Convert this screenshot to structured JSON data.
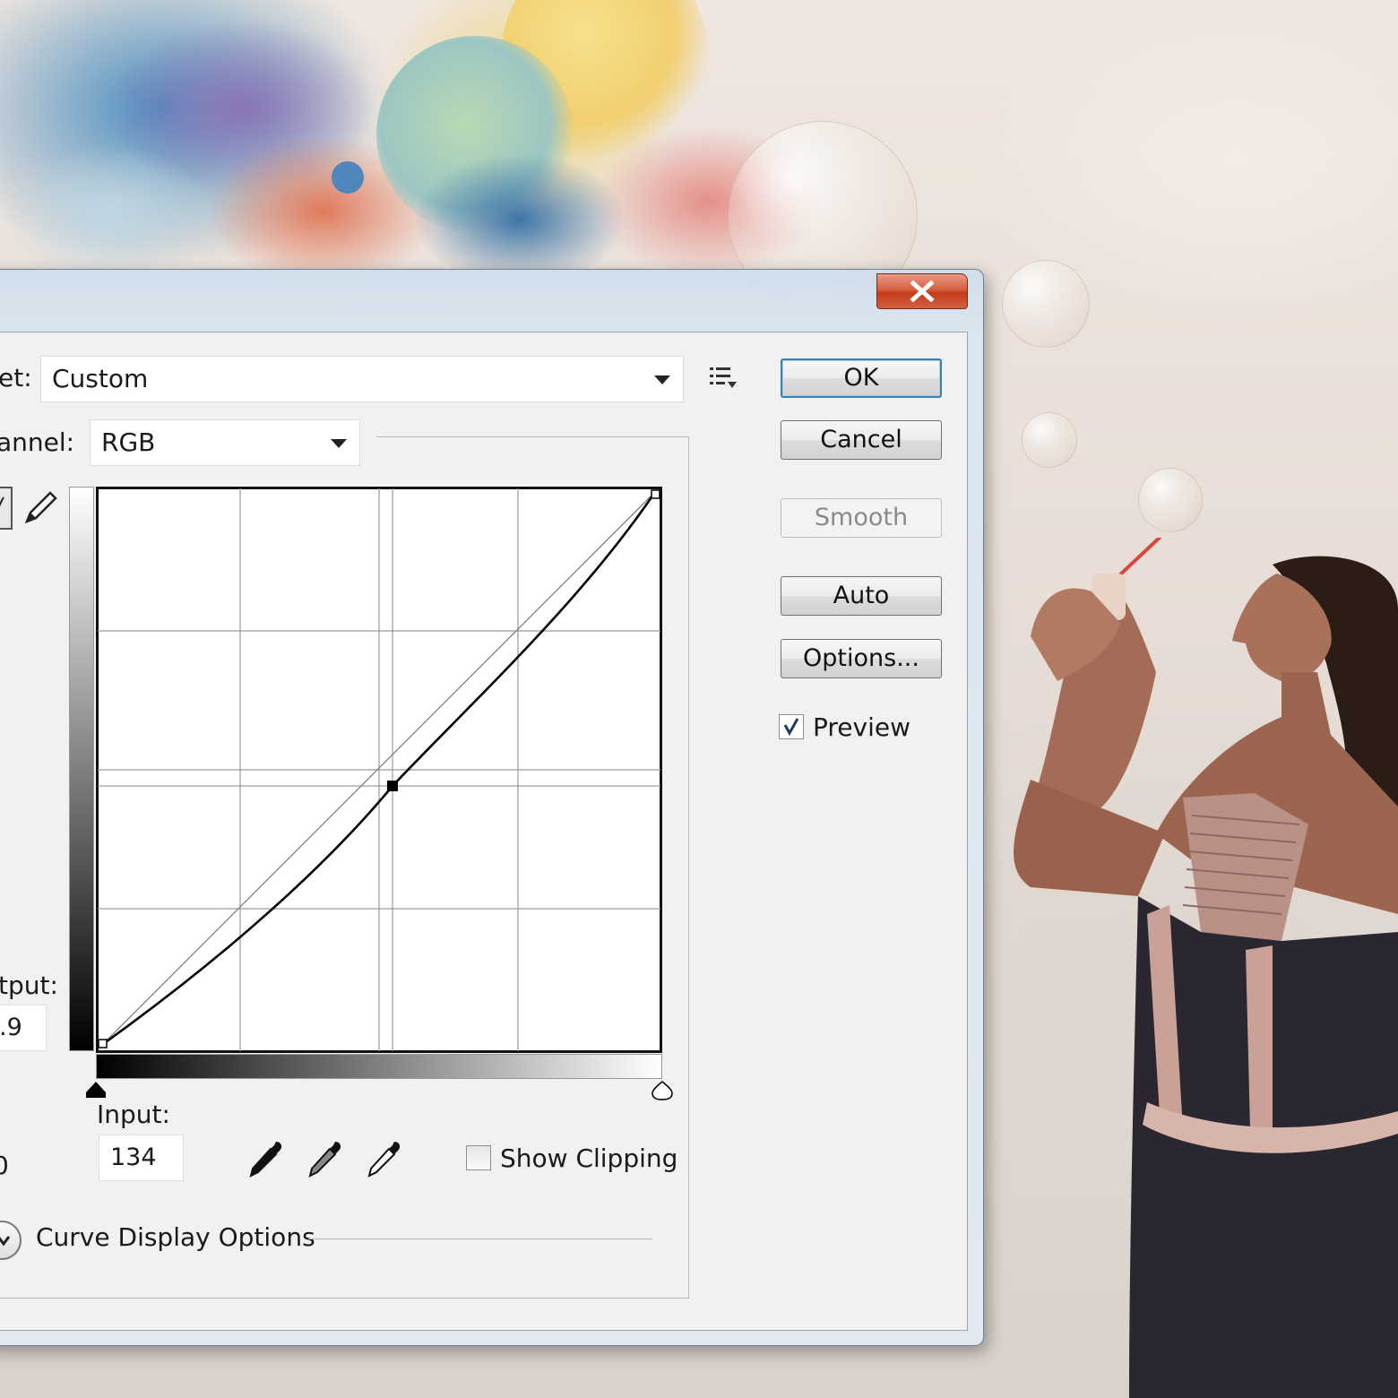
{
  "dialog": {
    "close_icon": "close-icon",
    "preset_label": "et:",
    "preset_value": "Custom",
    "preset_menu_icon": "preset-options-icon",
    "channel_label": "annel:",
    "channel_value": "RGB",
    "output_label": "tput:",
    "output_value": ".9",
    "input_label": "Input:",
    "input_value": "134",
    "buttons": {
      "ok": "OK",
      "cancel": "Cancel",
      "smooth": "Smooth",
      "auto": "Auto",
      "options": "Options..."
    },
    "preview_label": "Preview",
    "preview_checked": true,
    "show_clipping_label": "Show Clipping",
    "show_clipping_checked": false,
    "curve_display_label": "Curve Display Options",
    "partial_left_char": "0",
    "curve_point": {
      "input": 134,
      "output": 119
    },
    "colors": {
      "accent": "#3c7fb1",
      "close": "#c94a2a"
    }
  }
}
